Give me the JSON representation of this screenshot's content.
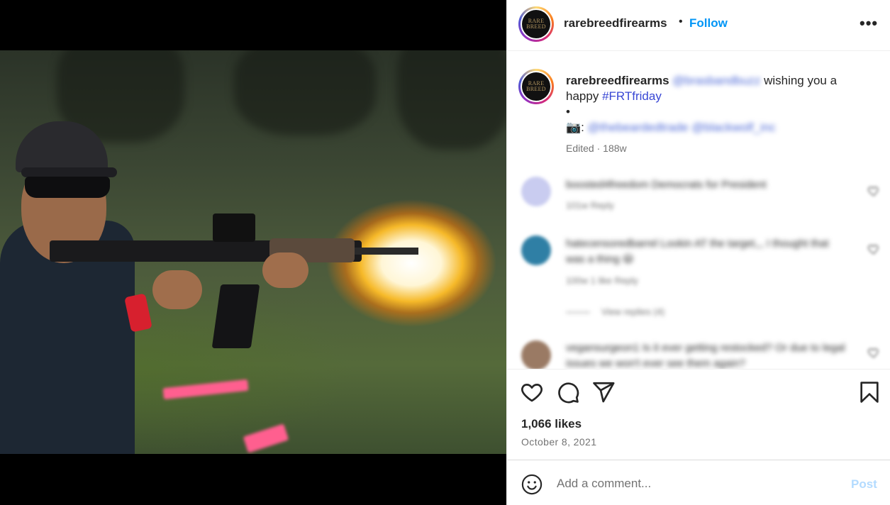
{
  "header": {
    "username": "rarebreedfirearms",
    "separator": "•",
    "follow_label": "Follow",
    "more_label": "•••",
    "logo_text_1": "RARE",
    "logo_text_2": "BREED"
  },
  "caption": {
    "username": "rarebreedfirearms",
    "mention": "@brasbandbuzz",
    "text_1": "wishing you a happy",
    "hashtag": "#FRTfriday",
    "bullet": "•",
    "camera": "📷:",
    "photo_credits": "@thebeardedtrade @blackwolf_inc",
    "edited": "Edited",
    "meta_sep": "·",
    "age": "188w"
  },
  "comments": [
    {
      "text": "boosted4freedom Democrats for President",
      "meta": "101w   Reply",
      "avatar_color": "#c9ccf0"
    },
    {
      "text": "hatecensoredbarrel Lookin AT the target,,, I thought that was a thing 😃",
      "meta": "100w   1 like   Reply",
      "avatar_color": "#2f7fa5"
    },
    {
      "text": "vegansurgeon1 Is it ever getting restocked? Or due to legal issues we won't ever see them again?",
      "meta": "",
      "avatar_color": "#9a7a64"
    }
  ],
  "view_replies": "View replies (4)",
  "actions": {
    "like_icon": "heart-icon",
    "comment_icon": "comment-icon",
    "share_icon": "share-icon",
    "save_icon": "bookmark-icon"
  },
  "likes": "1,066 likes",
  "date": "October 8, 2021",
  "composer": {
    "placeholder": "Add a comment...",
    "post_label": "Post",
    "emoji_icon": "smiley-icon"
  },
  "colors": {
    "follow": "#0095f6",
    "hashtag": "#3847d4",
    "post_disabled": "#b3dbff",
    "meta_text": "#737373"
  }
}
